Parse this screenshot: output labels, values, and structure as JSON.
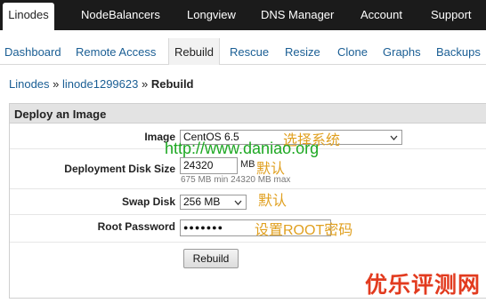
{
  "top_nav": {
    "items": [
      "Linodes",
      "NodeBalancers",
      "Longview",
      "DNS Manager",
      "Account",
      "Support"
    ],
    "active": "Linodes"
  },
  "sub_nav": {
    "items": [
      "Dashboard",
      "Remote Access",
      "Rebuild",
      "Rescue",
      "Resize",
      "Clone",
      "Graphs",
      "Backups"
    ],
    "active": "Rebuild"
  },
  "breadcrumb": {
    "root": "Linodes",
    "sep1": "»",
    "node": "linode1299623",
    "sep2": "»",
    "current": "Rebuild"
  },
  "panel": {
    "title": "Deploy an Image",
    "image": {
      "label": "Image",
      "value": "CentOS 6.5",
      "annotation": "选择系统"
    },
    "disk_size": {
      "label": "Deployment Disk Size",
      "value": "24320",
      "unit": "MB",
      "hint": "675 MB min 24320 MB max",
      "annotation": "默认"
    },
    "swap": {
      "label": "Swap Disk",
      "value": "256 MB",
      "annotation": "默认"
    },
    "root_password": {
      "label": "Root Password",
      "value": "●●●●●●●",
      "annotation": "设置ROOT密码"
    },
    "submit_label": "Rebuild"
  },
  "overlay": {
    "url": "http://www.daniao.org",
    "watermark": "优乐评测网"
  },
  "colors": {
    "nav_bg": "#1b1b1b",
    "link": "#1a5e94",
    "annotation": "#e0a020",
    "url": "#1da822",
    "watermark": "#e23b1f"
  }
}
